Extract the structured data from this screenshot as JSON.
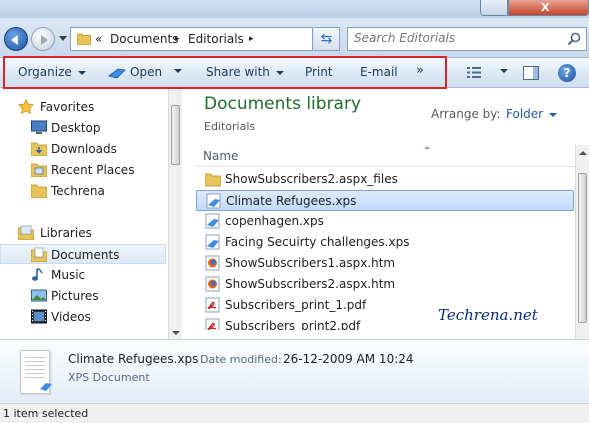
{
  "address": {
    "chevron": "«",
    "crumbs": [
      "Documents",
      "Editorials"
    ],
    "separator": "▸"
  },
  "search": {
    "placeholder": "Search Editorials"
  },
  "toolbar": {
    "organize": "Organize",
    "open": "Open",
    "share_with": "Share with",
    "print": "Print",
    "email": "E-mail",
    "more": "»"
  },
  "nav": {
    "favorites": {
      "label": "Favorites",
      "items": [
        {
          "label": "Desktop",
          "icon": "desktop-icon"
        },
        {
          "label": "Downloads",
          "icon": "downloads-folder-icon"
        },
        {
          "label": "Recent Places",
          "icon": "recent-places-icon"
        },
        {
          "label": "Techrena",
          "icon": "folder-icon"
        }
      ]
    },
    "libraries": {
      "label": "Libraries",
      "items": [
        {
          "label": "Documents",
          "icon": "documents-library-icon",
          "selected": true
        },
        {
          "label": "Music",
          "icon": "music-icon"
        },
        {
          "label": "Pictures",
          "icon": "pictures-icon"
        },
        {
          "label": "Videos",
          "icon": "videos-icon"
        }
      ]
    }
  },
  "main": {
    "library_title": "Documents library",
    "library_subtitle": "Editorials",
    "arrange_label": "Arrange by:",
    "arrange_value": "Folder",
    "column_name": "Name",
    "files": [
      {
        "name": "ShowSubscribers2.aspx_files",
        "icon": "folder-icon"
      },
      {
        "name": "Climate Refugees.xps",
        "icon": "xps-file-icon",
        "selected": true
      },
      {
        "name": "copenhagen.xps",
        "icon": "xps-file-icon"
      },
      {
        "name": "Facing Secuirty challenges.xps",
        "icon": "xps-file-icon"
      },
      {
        "name": "ShowSubscribers1.aspx.htm",
        "icon": "firefox-html-icon"
      },
      {
        "name": "ShowSubscribers2.aspx.htm",
        "icon": "firefox-html-icon"
      },
      {
        "name": "Subscribers_print_1.pdf",
        "icon": "pdf-file-icon"
      },
      {
        "name": "Subscribers_print2.pdf",
        "icon": "pdf-file-icon"
      }
    ],
    "watermark": "Techrena.net"
  },
  "details": {
    "file_name": "Climate Refugees.xps",
    "modified_label": "Date modified:",
    "modified_value": "26-12-2009 AM 10:24",
    "file_type": "XPS Document"
  },
  "status": {
    "text": "1 item selected"
  },
  "window": {
    "close_glyph": "X"
  },
  "colors": {
    "accent": "#1f59b4",
    "library_title": "#1e6e2c",
    "highlight_box": "#d8232a",
    "watermark": "#0a2a7a"
  }
}
